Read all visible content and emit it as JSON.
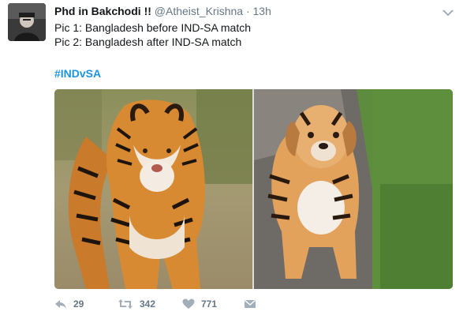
{
  "tweet": {
    "author_name": "Phd in Bakchodi !!",
    "handle": "@Atheist_Krishna",
    "separator": "·",
    "time": "13h",
    "lines": [
      "Pic 1: Bangladesh before IND-SA match",
      "Pic 2: Bangladesh after IND-SA match"
    ],
    "hashtag": "#INDvSA"
  },
  "media": {
    "photos": [
      {
        "subject": "tiger"
      },
      {
        "subject": "dog-painted-with-tiger-stripes"
      }
    ]
  },
  "actions": {
    "reply_count": "29",
    "retweet_count": "342",
    "like_count": "771"
  },
  "colors": {
    "link": "#1b95e0",
    "muted": "#657786",
    "text": "#14171a"
  },
  "icons": [
    "avatar",
    "chevron-down-icon",
    "reply-icon",
    "retweet-icon",
    "heart-icon",
    "direct-message-icon"
  ]
}
